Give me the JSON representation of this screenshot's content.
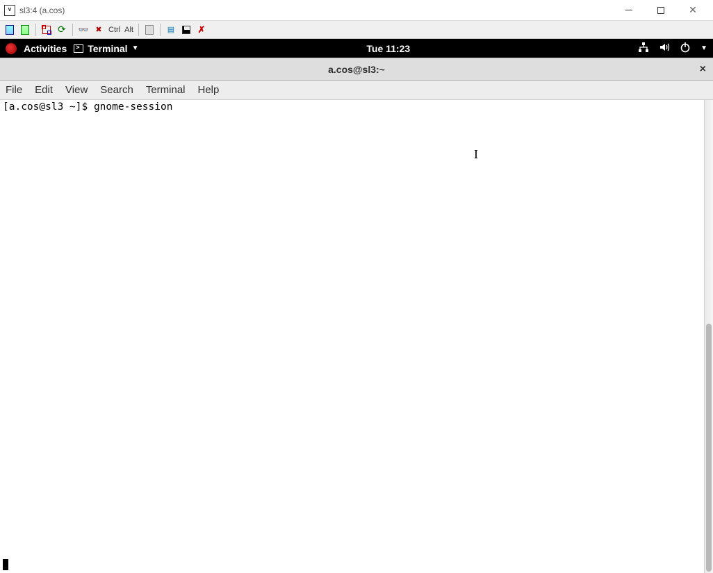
{
  "window": {
    "title": "sl3:4 (a.cos)"
  },
  "vnc_toolbar": {
    "ctrl": "Ctrl",
    "alt": "Alt"
  },
  "gnome": {
    "activities": "Activities",
    "app_name": "Terminal",
    "clock": "Tue 11:23"
  },
  "terminal": {
    "title": "a.cos@sl3:~",
    "menu": {
      "file": "File",
      "edit": "Edit",
      "view": "View",
      "search": "Search",
      "terminal": "Terminal",
      "help": "Help"
    },
    "prompt": "[a.cos@sl3 ~]$ ",
    "command": "gnome-session"
  }
}
